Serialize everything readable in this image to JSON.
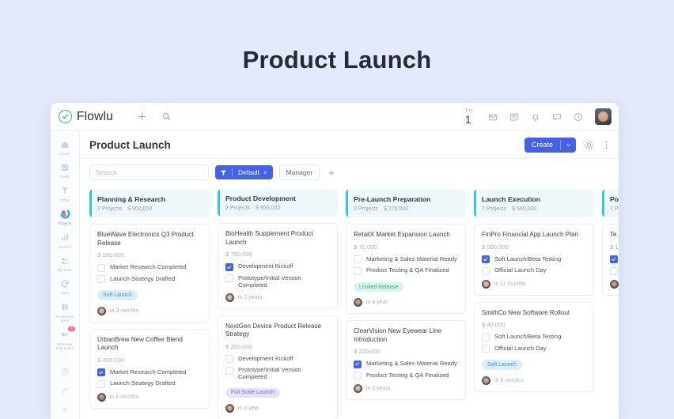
{
  "page_heading": "Product Launch",
  "topbar": {
    "brand": "Flowlu",
    "add_icon": "plus-icon",
    "search_icon": "search-icon",
    "date_dow": "Tue",
    "date_num": "1",
    "icons": [
      "mail-icon",
      "note-icon",
      "bell-icon",
      "chat-icon",
      "help-icon"
    ],
    "avatar": "user-avatar"
  },
  "sidebar": {
    "items": [
      {
        "label": "Home",
        "icon": "home-icon",
        "active": false,
        "badge": ""
      },
      {
        "label": "Tasks",
        "icon": "tasks-icon",
        "active": false,
        "badge": ""
      },
      {
        "label": "CRM",
        "icon": "crm-icon",
        "active": false,
        "badge": ""
      },
      {
        "label": "Projects",
        "icon": "projects-icon",
        "active": true,
        "badge": ""
      },
      {
        "label": "Finance",
        "icon": "finance-icon",
        "active": false,
        "badge": ""
      },
      {
        "label": "My Team",
        "icon": "team-icon",
        "active": false,
        "badge": ""
      },
      {
        "label": "Agile",
        "icon": "agile-icon",
        "active": false,
        "badge": ""
      },
      {
        "label": "Knowledge Base",
        "icon": "knowledge-icon",
        "active": false,
        "badge": ""
      },
      {
        "label": "Business Processes",
        "icon": "processes-icon",
        "active": false,
        "badge": "10"
      }
    ],
    "more": "...",
    "footer_icons": [
      "plugin-icon",
      "settings-icon",
      "collapse-icon"
    ]
  },
  "header": {
    "title": "Product Launch",
    "create_label": "Create",
    "create_caret": "chevron-down-icon",
    "gear": "gear-icon",
    "kebab": "more-vertical-icon"
  },
  "filters": {
    "search_placeholder": "Search",
    "filter_icon": "filter-icon",
    "default_label": "Default",
    "default_close": "×",
    "manager_label": "Manager",
    "add_label": "+"
  },
  "board": {
    "columns": [
      {
        "title": "Planning & Research",
        "projects": "2 Projects",
        "amount": "$ 900,000",
        "cards": [
          {
            "title": "BlueWave Electronics Q3 Product Release",
            "amount": "$ 500,000",
            "todos": [
              {
                "label": "Market Research Completed",
                "checked": false
              },
              {
                "label": "Launch Strategy Drafted",
                "checked": false
              }
            ],
            "tag": "Soft Launch",
            "tag_style": "soft",
            "due": "in 3 months",
            "avatar": "a1"
          },
          {
            "title": "UrbanBrew New Coffee Blend Launch",
            "amount": "$ 400,000",
            "todos": [
              {
                "label": "Market Research Completed",
                "checked": true
              },
              {
                "label": "Launch Strategy Drafted",
                "checked": false
              }
            ],
            "tag": "",
            "tag_style": "",
            "due": "in 6 months",
            "avatar": "a2"
          }
        ]
      },
      {
        "title": "Product Development",
        "projects": "2 Projects",
        "amount": "$ 950,000",
        "cards": [
          {
            "title": "BioHealth Supplement Product Launch",
            "amount": "$ 750,000",
            "todos": [
              {
                "label": "Development Kickoff",
                "checked": true
              },
              {
                "label": "Prototype/Initial Version Completed",
                "checked": false
              }
            ],
            "tag": "",
            "tag_style": "",
            "due": "in 2 years",
            "avatar": "a3"
          },
          {
            "title": "NextGen Device Product Release Strategy",
            "amount": "$ 200,000",
            "todos": [
              {
                "label": "Development Kickoff",
                "checked": false
              },
              {
                "label": "Prototype/Initial Version Completed",
                "checked": false
              }
            ],
            "tag": "Full Scale Launch",
            "tag_style": "full",
            "due": "in a year",
            "avatar": "a4"
          }
        ]
      },
      {
        "title": "Pre-Launch Preparation",
        "projects": "2 Projects",
        "amount": "$ 270,000",
        "cards": [
          {
            "title": "RetailX Market Expansion Launch",
            "amount": "$ 70,000",
            "todos": [
              {
                "label": "Marketing & Sales Material Ready",
                "checked": false
              },
              {
                "label": "Product Testing & QA Finalized",
                "checked": false
              }
            ],
            "tag": "Limited Release",
            "tag_style": "limited",
            "due": "in a year",
            "avatar": "a2"
          },
          {
            "title": "ClearVision New Eyewear Line Introduction",
            "amount": "$ 200,000",
            "todos": [
              {
                "label": "Marketing & Sales Material Ready",
                "checked": true
              },
              {
                "label": "Product Testing & QA Finalized",
                "checked": false
              }
            ],
            "tag": "",
            "tag_style": "",
            "due": "in 2 years",
            "avatar": "a3"
          }
        ]
      },
      {
        "title": "Launch Execution",
        "projects": "2 Projects",
        "amount": "$ 540,000",
        "cards": [
          {
            "title": "FinPro Financial App Launch Plan",
            "amount": "$ 500,000",
            "todos": [
              {
                "label": "Soft Launch/Beta Testing",
                "checked": true
              },
              {
                "label": "Official Launch Day",
                "checked": false
              }
            ],
            "tag": "",
            "tag_style": "",
            "due": "in 11 months",
            "avatar": "a1"
          },
          {
            "title": "SmithCo New Software Rollout",
            "amount": "$ 40,000",
            "todos": [
              {
                "label": "Soft Launch/Beta Testing",
                "checked": false
              },
              {
                "label": "Official Launch Day",
                "checked": false
              }
            ],
            "tag": "Soft Launch",
            "tag_style": "soft",
            "due": "in 8 months",
            "avatar": "a4"
          }
        ]
      },
      {
        "title": "Po",
        "projects": "1 P",
        "amount": "",
        "cards": [
          {
            "title": "Te",
            "amount": "$ 1",
            "todos": [
              {
                "label": "",
                "checked": true
              },
              {
                "label": "",
                "checked": false
              }
            ],
            "tag": "",
            "tag_style": "",
            "due": "",
            "avatar": "a2"
          }
        ]
      }
    ]
  },
  "colors": {
    "page_bg": "#e3eafb",
    "accent_blue": "#4461e8",
    "column_accent": "#32c8d8",
    "column_bg": "#eef8fa",
    "brand_green": "#2ec27e"
  }
}
